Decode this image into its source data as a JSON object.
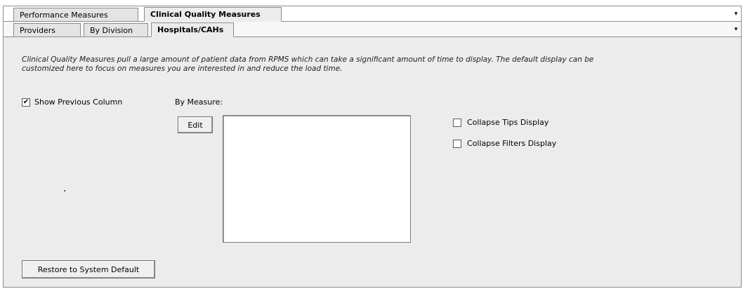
{
  "outer_tabs": [
    {
      "label": "Performance Measures",
      "active": false
    },
    {
      "label": "Clinical Quality Measures",
      "active": true
    }
  ],
  "inner_tabs": [
    {
      "label": "Providers",
      "active": false
    },
    {
      "label": "By Division",
      "active": false
    },
    {
      "label": "Hospitals/CAHs",
      "active": true
    }
  ],
  "description": "Clinical Quality Measures pull a large amount of patient data from RPMS which can take a significant amount of time to display.  The default display can be customized here to focus on measures you are interested in and reduce the load time.",
  "options": {
    "show_previous_column": {
      "label": "Show Previous Column",
      "checked": true
    },
    "collapse_tips": {
      "label": "Collapse Tips Display",
      "checked": false
    },
    "collapse_filters": {
      "label": "Collapse Filters Display",
      "checked": false
    }
  },
  "by_measure": {
    "label": "By Measure:",
    "edit_label": "Edit",
    "items": []
  },
  "restore_label": "Restore to System Default",
  "icons": {
    "check_glyph": "✔",
    "dropdown_glyph": "▾"
  }
}
